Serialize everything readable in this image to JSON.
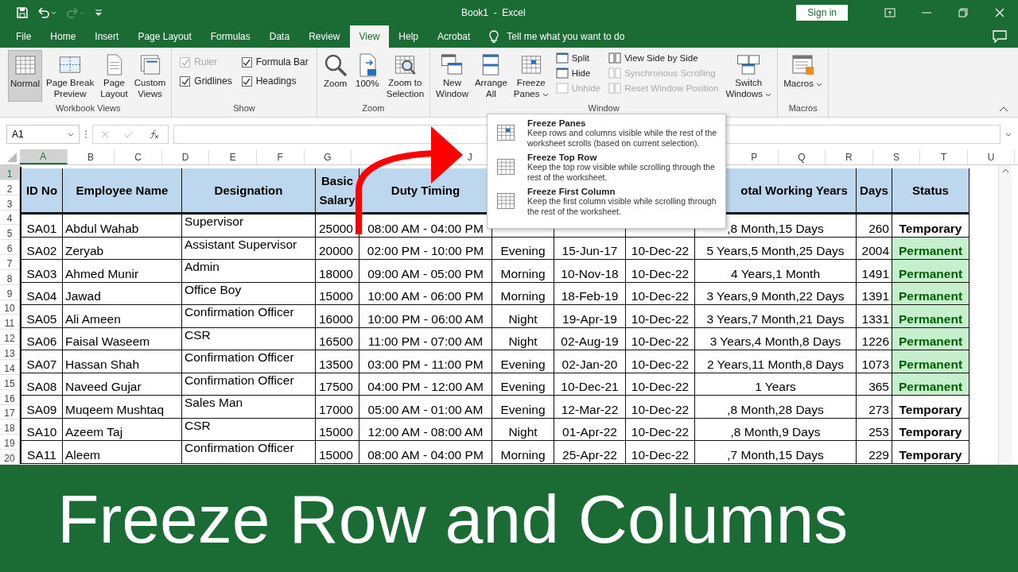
{
  "window": {
    "title": "Book1  -  Excel",
    "sign_in": "Sign in"
  },
  "tabs": [
    {
      "label": "File",
      "selected": false
    },
    {
      "label": "Home",
      "selected": false
    },
    {
      "label": "Insert",
      "selected": false
    },
    {
      "label": "Page Layout",
      "selected": false
    },
    {
      "label": "Formulas",
      "selected": false
    },
    {
      "label": "Data",
      "selected": false
    },
    {
      "label": "Review",
      "selected": false
    },
    {
      "label": "View",
      "selected": true
    },
    {
      "label": "Help",
      "selected": false
    },
    {
      "label": "Acrobat",
      "selected": false
    }
  ],
  "tell_me": "Tell me what you want to do",
  "ribbon": {
    "groups": [
      {
        "label": "Workbook Views",
        "items": [
          {
            "kind": "large",
            "label": "Normal",
            "selected": true,
            "dropdown": false
          },
          {
            "kind": "large",
            "label": "Page Break\nPreview",
            "selected": false,
            "dropdown": false
          },
          {
            "kind": "large",
            "label": "Page\nLayout",
            "selected": false,
            "dropdown": false
          },
          {
            "kind": "large",
            "label": "Custom\nViews",
            "selected": false,
            "dropdown": false
          }
        ]
      },
      {
        "label": "Show",
        "items": [
          {
            "kind": "checkbox",
            "label": "Ruler",
            "checked": true,
            "disabled": true
          },
          {
            "kind": "checkbox",
            "label": "Formula Bar",
            "checked": true,
            "disabled": false
          },
          {
            "kind": "checkbox",
            "label": "Gridlines",
            "checked": true,
            "disabled": false
          },
          {
            "kind": "checkbox",
            "label": "Headings",
            "checked": true,
            "disabled": false
          }
        ]
      },
      {
        "label": "Zoom",
        "items": [
          {
            "kind": "large",
            "label": "Zoom",
            "selected": false,
            "dropdown": false
          },
          {
            "kind": "large",
            "label": "100%",
            "selected": false,
            "dropdown": false
          },
          {
            "kind": "large",
            "label": "Zoom to\nSelection",
            "selected": false,
            "dropdown": false
          }
        ]
      },
      {
        "label": "Window",
        "items": [
          {
            "kind": "large",
            "label": "New\nWindow",
            "selected": false,
            "dropdown": false
          },
          {
            "kind": "large",
            "label": "Arrange\nAll",
            "selected": false,
            "dropdown": false
          },
          {
            "kind": "large",
            "label": "Freeze\nPanes",
            "selected": false,
            "dropdown": true
          },
          {
            "kind": "small",
            "label": "Split",
            "disabled": false
          },
          {
            "kind": "small",
            "label": "Hide",
            "disabled": false
          },
          {
            "kind": "small",
            "label": "Unhide",
            "disabled": true
          },
          {
            "kind": "small",
            "label": "View Side by Side",
            "disabled": false
          },
          {
            "kind": "small",
            "label": "Synchronous Scrolling",
            "disabled": true
          },
          {
            "kind": "small",
            "label": "Reset Window Position",
            "disabled": true
          },
          {
            "kind": "large",
            "label": "Switch\nWindows",
            "selected": false,
            "dropdown": true
          }
        ]
      },
      {
        "label": "Macros",
        "items": [
          {
            "kind": "large",
            "label": "Macros",
            "selected": false,
            "dropdown": true
          }
        ]
      }
    ]
  },
  "formula_bar": {
    "name_box": "A1"
  },
  "column_headers": [
    {
      "label": "A",
      "selected": true
    },
    {
      "label": "B",
      "selected": false
    },
    {
      "label": "C",
      "selected": false
    },
    {
      "label": "D",
      "selected": false
    },
    {
      "label": "E",
      "selected": false
    },
    {
      "label": "F",
      "selected": false
    },
    {
      "label": "G",
      "selected": false
    },
    {
      "label": "J",
      "selected": false
    },
    {
      "label": "P",
      "selected": false
    },
    {
      "label": "Q",
      "selected": false
    },
    {
      "label": "R",
      "selected": false
    },
    {
      "label": "S",
      "selected": false
    },
    {
      "label": "T",
      "selected": false
    },
    {
      "label": "U",
      "selected": false
    }
  ],
  "row_headers": [
    {
      "label": "1",
      "selected": true
    },
    {
      "label": "2",
      "selected": false
    },
    {
      "label": "3",
      "selected": false
    },
    {
      "label": "4",
      "selected": false
    },
    {
      "label": "5",
      "selected": false
    },
    {
      "label": "6",
      "selected": false
    },
    {
      "label": "7",
      "selected": false
    },
    {
      "label": "8",
      "selected": false
    },
    {
      "label": "9",
      "selected": false
    },
    {
      "label": "10",
      "selected": false
    },
    {
      "label": "11",
      "selected": false
    },
    {
      "label": "12",
      "selected": false
    },
    {
      "label": "13",
      "selected": false
    },
    {
      "label": "14",
      "selected": false
    },
    {
      "label": "15",
      "selected": false
    },
    {
      "label": "16",
      "selected": false
    },
    {
      "label": "17",
      "selected": false
    },
    {
      "label": "18",
      "selected": false
    },
    {
      "label": "19",
      "selected": false
    },
    {
      "label": "20",
      "selected": false
    }
  ],
  "table": {
    "columns": {
      "id": "ID No",
      "name": "Employee Name",
      "designation": "Designation",
      "salary": "Basic Salary",
      "duty": "Duty Timing",
      "total": "otal Working Years",
      "days": "Days",
      "status": "Status"
    },
    "rows": [
      {
        "id": "SA01",
        "name": "Abdul Wahab",
        "designation": "Supervisor",
        "salary": "25000",
        "duty": "08:00 AM - 04:00 PM",
        "total": ",8 Month,15 Days",
        "days": "260",
        "status": "Temporary",
        "status_highlighted": false
      },
      {
        "id": "SA02",
        "name": "Zeryab",
        "designation": "Assistant Supervisor",
        "salary": "20000",
        "duty": "02:00 PM - 10:00 PM",
        "shift": "Evening",
        "joined": "15-Jun-17",
        "ended": "10-Dec-22",
        "total": "5 Years,5 Month,25 Days",
        "days": "2004",
        "status": "Permanent",
        "status_highlighted": true
      },
      {
        "id": "SA03",
        "name": "Ahmed Munir",
        "designation": "Admin",
        "salary": "18000",
        "duty": "09:00 AM - 05:00 PM",
        "shift": "Morning",
        "joined": "10-Nov-18",
        "ended": "10-Dec-22",
        "total": "4 Years,1 Month",
        "days": "1491",
        "status": "Permanent",
        "status_highlighted": true
      },
      {
        "id": "SA04",
        "name": "Jawad",
        "designation": "Office Boy",
        "salary": "15000",
        "duty": "10:00 AM - 06:00 PM",
        "shift": "Morning",
        "joined": "18-Feb-19",
        "ended": "10-Dec-22",
        "total": "3 Years,9 Month,22 Days",
        "days": "1391",
        "status": "Permanent",
        "status_highlighted": true
      },
      {
        "id": "SA05",
        "name": "Ali Ameen",
        "designation": "Confirmation Officer",
        "salary": "16000",
        "duty": "10:00 PM - 06:00 AM",
        "shift": "Night",
        "joined": "19-Apr-19",
        "ended": "10-Dec-22",
        "total": "3 Years,7 Month,21 Days",
        "days": "1331",
        "status": "Permanent",
        "status_highlighted": true
      },
      {
        "id": "SA06",
        "name": "Faisal Waseem",
        "designation": "CSR",
        "salary": "16500",
        "duty": "11:00 PM - 07:00 AM",
        "shift": "Night",
        "joined": "02-Aug-19",
        "ended": "10-Dec-22",
        "total": "3 Years,4 Month,8 Days",
        "days": "1226",
        "status": "Permanent",
        "status_highlighted": true
      },
      {
        "id": "SA07",
        "name": "Hassan Shah",
        "designation": "Confirmation Officer",
        "salary": "13500",
        "duty": "03:00 PM - 11:00 PM",
        "shift": "Evening",
        "joined": "02-Jan-20",
        "ended": "10-Dec-22",
        "total": "2 Years,11 Month,8 Days",
        "days": "1073",
        "status": "Permanent",
        "status_highlighted": true
      },
      {
        "id": "SA08",
        "name": "Naveed Gujar",
        "designation": "Confirmation Officer",
        "salary": "17500",
        "duty": "04:00 PM - 12:00 AM",
        "shift": "Evening",
        "joined": "10-Dec-21",
        "ended": "10-Dec-22",
        "total": "1 Years",
        "days": "365",
        "status": "Permanent",
        "status_highlighted": true
      },
      {
        "id": "SA09",
        "name": "Muqeem Mushtaq",
        "designation": "Sales Man",
        "salary": "17000",
        "duty": "05:00 AM - 01:00 AM",
        "shift": "Evening",
        "joined": "12-Mar-22",
        "ended": "10-Dec-22",
        "total": ",8 Month,28 Days",
        "days": "273",
        "status": "Temporary",
        "status_highlighted": false
      },
      {
        "id": "SA10",
        "name": "Azeem Taj",
        "designation": "CSR",
        "salary": "15000",
        "duty": "12:00 AM - 08:00 AM",
        "shift": "Night",
        "joined": "01-Apr-22",
        "ended": "10-Dec-22",
        "total": ",8 Month,9 Days",
        "days": "253",
        "status": "Temporary",
        "status_highlighted": false
      },
      {
        "id": "SA11",
        "name": "Aleem",
        "designation": "Confirmation Officer",
        "salary": "15000",
        "duty": "08:00 AM - 04:00 PM",
        "shift": "Morning",
        "joined": "25-Apr-22",
        "ended": "10-Dec-22",
        "total": ",7 Month,15 Days",
        "days": "229",
        "status": "Temporary",
        "status_highlighted": false
      }
    ]
  },
  "freeze_menu": {
    "items": [
      {
        "title": "Freeze Panes",
        "description": "Keep rows and columns visible while the rest of the worksheet scrolls (based on current selection)."
      },
      {
        "title": "Freeze Top Row",
        "description": "Keep the top row visible while scrolling through the rest of the worksheet."
      },
      {
        "title": "Freeze First Column",
        "description": "Keep the first column visible while scrolling through the rest of the worksheet."
      }
    ]
  },
  "banner": {
    "text": "Freeze Row and Columns"
  }
}
